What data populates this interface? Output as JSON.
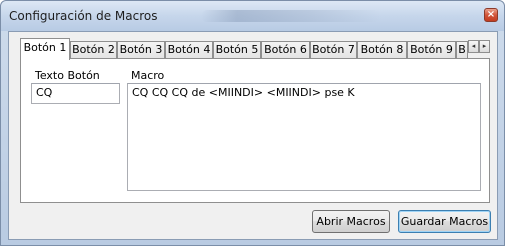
{
  "window": {
    "title": "Configuración de Macros",
    "close_glyph": "×"
  },
  "tabs": [
    {
      "label": "Botón 1",
      "selected": true
    },
    {
      "label": "Botón 2",
      "selected": false
    },
    {
      "label": "Botón 3",
      "selected": false
    },
    {
      "label": "Botón 4",
      "selected": false
    },
    {
      "label": "Botón 5",
      "selected": false
    },
    {
      "label": "Botón 6",
      "selected": false
    },
    {
      "label": "Botón 7",
      "selected": false
    },
    {
      "label": "Botón 8",
      "selected": false
    },
    {
      "label": "Botón 9",
      "selected": false
    },
    {
      "label": "B",
      "selected": false
    }
  ],
  "tab_scroll": {
    "left_icon": "◂",
    "right_icon": "▸"
  },
  "form": {
    "button_text_label": "Texto Botón",
    "button_text_value": "CQ",
    "macro_label": "Macro",
    "macro_value": "CQ CQ CQ de <MIINDI> <MIINDI> pse K"
  },
  "buttons": {
    "open_macros": "Abrir Macros",
    "save_macros": "Guardar Macros"
  },
  "colors": {
    "title_bar": "#c6d6eb",
    "client_bg": "#f0f0f0",
    "close_button": "#d2553a",
    "default_button_border": "#3c7fb1"
  }
}
